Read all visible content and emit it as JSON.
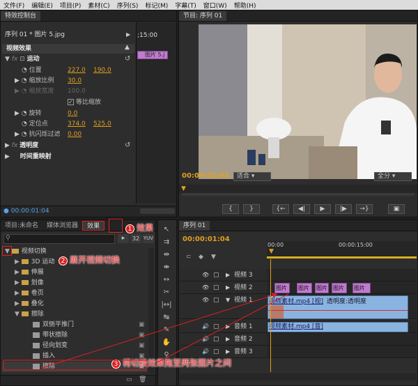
{
  "menu": [
    "文件(F)",
    "编辑(E)",
    "项目(P)",
    "素材(C)",
    "序列(S)",
    "标记(M)",
    "字幕(T)",
    "窗口(W)",
    "帮助(H)"
  ],
  "effect_controls": {
    "tab": "特效控制台",
    "sequence_title": "序列 01 * 图片 5.jpg",
    "ruler_time": ";15:00",
    "clip_label": "图片 5.j",
    "video_effects": "视频效果",
    "motion": "运动",
    "position_label": "位置",
    "position_x": "227.0",
    "position_y": "190.0",
    "scale_label": "缩放比例",
    "scale_value": "30.0",
    "scale_width_label": "缩放宽度",
    "scale_width_value": "100.0",
    "uniform_label": "等比缩放",
    "rotation_label": "旋转",
    "rotation_value": "0.0",
    "anchor_label": "定位点",
    "anchor_x": "374.0",
    "anchor_y": "525.0",
    "antiflicker_label": "抗闪烁过滤",
    "antiflicker_value": "0.00",
    "opacity_label": "透明度",
    "time_remap_label": "时间重映射",
    "timecode": "00:00:01:04"
  },
  "program": {
    "tab": "节目: 序列 01",
    "timecode": "00:00:01:04",
    "fit": "适合",
    "quality": "全分"
  },
  "project": {
    "tabs": [
      "项目:未命名",
      "媒体浏览器",
      "效果"
    ],
    "items": [
      {
        "label": "视频切换",
        "indent": 0,
        "open": true,
        "type": "folder"
      },
      {
        "label": "3D 运动",
        "indent": 1,
        "open": false,
        "type": "folder"
      },
      {
        "label": "伸展",
        "indent": 1,
        "open": false,
        "type": "folder"
      },
      {
        "label": "划像",
        "indent": 1,
        "open": false,
        "type": "folder"
      },
      {
        "label": "卷页",
        "indent": 1,
        "open": false,
        "type": "folder"
      },
      {
        "label": "叠化",
        "indent": 1,
        "open": false,
        "type": "folder"
      },
      {
        "label": "擦除",
        "indent": 1,
        "open": true,
        "type": "folder"
      },
      {
        "label": "双侧平推门",
        "indent": 2,
        "type": "fx"
      },
      {
        "label": "带状擦除",
        "indent": 2,
        "type": "fx"
      },
      {
        "label": "径向划变",
        "indent": 2,
        "type": "fx"
      },
      {
        "label": "插入",
        "indent": 2,
        "type": "fx"
      },
      {
        "label": "擦除",
        "indent": 2,
        "type": "fx"
      }
    ]
  },
  "timeline": {
    "tab": "序列 01",
    "timecode": "00:00:01:04",
    "ruler_start": "00:00",
    "ruler_mid": "00:00:15:00",
    "tracks": [
      {
        "label": "视频 3"
      },
      {
        "label": "视频 2"
      },
      {
        "label": "视频 1"
      },
      {
        "label": "音频 1"
      },
      {
        "label": "音频 2"
      },
      {
        "label": "音频 3"
      }
    ],
    "image_clip": "图片",
    "video_clip": "视频素材.mp4 [视]",
    "video_clip_extra": "透明度:透明度",
    "audio_clip": "视频素材.mp4 [音]"
  },
  "callouts": {
    "c1_num": "1",
    "c1_text": "效果",
    "c2_num": "2",
    "c2_text": "展开视频切换",
    "c3_num": "3",
    "c3_text": "将切换效果拖至两张图片之间"
  },
  "colors": {
    "accent": "#e0a020",
    "clip": "#c07ad0",
    "video_clip": "#8ab4e0",
    "callout": "#ff3333"
  }
}
